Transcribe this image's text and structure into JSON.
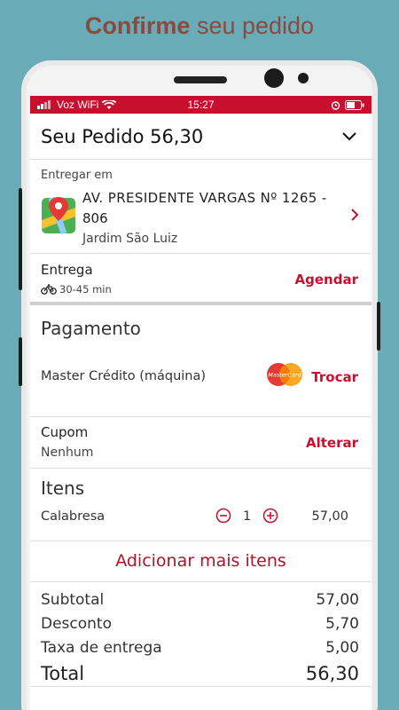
{
  "headline": {
    "bold": "Confirme",
    "rest": " seu pedido"
  },
  "status": {
    "carrier": "Voz WiFi",
    "time": "15:27"
  },
  "header": {
    "title": "Seu Pedido 56,30"
  },
  "address": {
    "label": "Entregar em",
    "line1": "AV. PRESIDENTE VARGAS Nº 1265 -",
    "line2": "806",
    "neighborhood": "Jardim São Luiz"
  },
  "delivery": {
    "title": "Entrega",
    "eta": "30-45 min",
    "action": "Agendar"
  },
  "payment": {
    "title": "Pagamento",
    "method": "Master Crédito (máquina)",
    "card_brand": "MasterCard",
    "action": "Trocar"
  },
  "coupon": {
    "title": "Cupom",
    "value": "Nenhum",
    "action": "Alterar"
  },
  "items": {
    "title": "Itens",
    "list": [
      {
        "name": "Calabresa",
        "qty": "1",
        "price": "57,00"
      }
    ]
  },
  "add_more": "Adicionar mais itens",
  "totals": {
    "subtotal_label": "Subtotal",
    "subtotal": "57,00",
    "discount_label": "Desconto",
    "discount": "5,70",
    "fee_label": "Taxa de entrega",
    "fee": "5,00",
    "total_label": "Total",
    "total": "56,30"
  },
  "colors": {
    "accent": "#c8102e",
    "background": "#6aabb8",
    "headline": "#8a4a3c"
  }
}
